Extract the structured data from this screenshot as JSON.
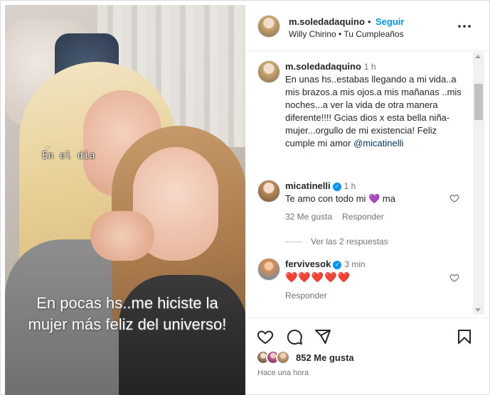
{
  "post": {
    "username": "m.soledadaquino",
    "follow_label": "Seguir",
    "audio": "Willy Chirino • Tu Cumpleaños",
    "photo_overlay_small": "En el día",
    "photo_overlay_dots": "...",
    "photo_overlay_big": "En pocas hs..me hiciste la mujer más feliz del universo!"
  },
  "comments": [
    {
      "username": "m.soledadaquino",
      "time": "1 h",
      "text": "En unas hs..estabas llegando a mi vida..a mis brazos.a mis ojos.a mis mañanas ..mis noches...a ver la vida de otra manera diferente!!!! Gcias dios x esta bella niña-mujer...orgullo de mi existencia! Feliz cumple mi amor",
      "mention": "@micatinelli"
    },
    {
      "username": "micatinelli",
      "verified": true,
      "time": "1 h",
      "text_before": "Te amo con todo mi",
      "emoji": "💜",
      "text_after": "ma",
      "likes": "32 Me gusta",
      "reply_label": "Responder",
      "view_replies": "Ver las 2 respuestas"
    },
    {
      "username": "fervivesok",
      "verified": true,
      "time": "3 min",
      "text": "❤️❤️❤️❤️❤️",
      "reply_label": "Responder"
    }
  ],
  "actions": {
    "likes": "852 Me gusta",
    "posted": "Hace una hora"
  },
  "icons": [
    "more-icon",
    "heart-icon",
    "comment-icon",
    "share-icon",
    "bookmark-icon",
    "verified-badge"
  ],
  "colors": {
    "accent": "#0095f6",
    "text": "#262626",
    "muted": "#737373",
    "heart": "#ed4956"
  }
}
